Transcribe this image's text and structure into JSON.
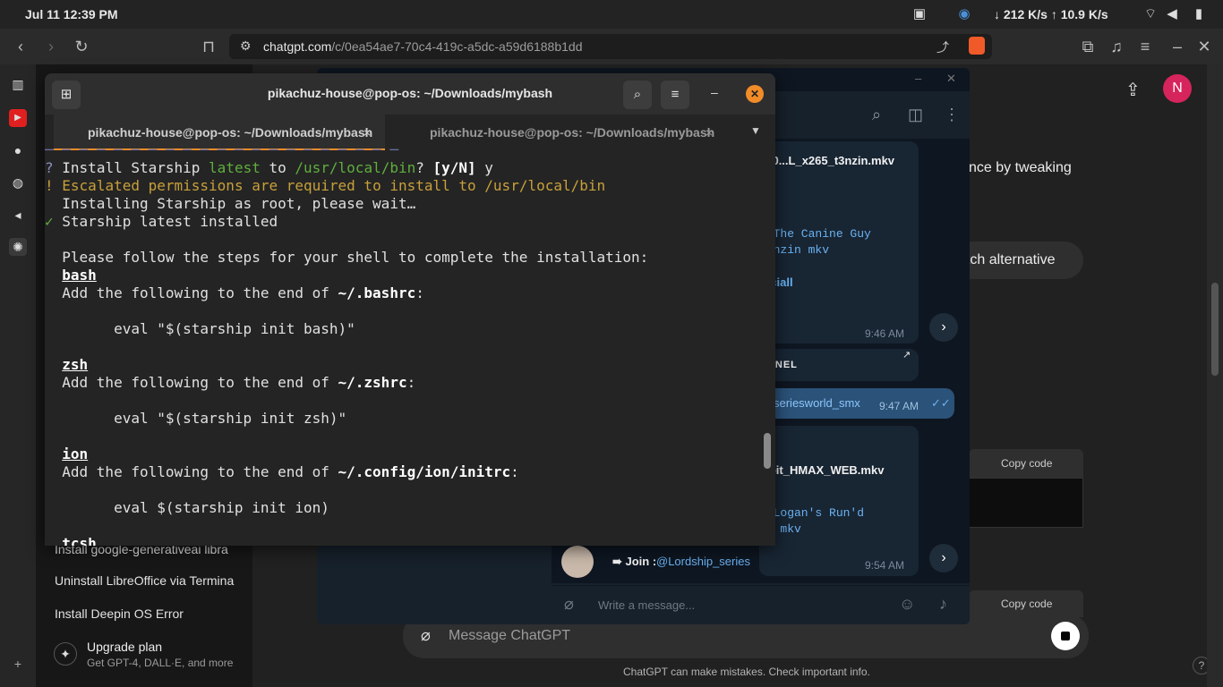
{
  "system": {
    "datetime": "Jul 11  12:39 PM",
    "network": "↓ 212 K/s ↑ 10.9 K/s"
  },
  "browser": {
    "url_host": "chatgpt.com",
    "url_path": "/c/0ea54ae7-70c4-419c-a5dc-a59d6188b1dd"
  },
  "chatgpt": {
    "history": [
      "Install google-generativeai libra",
      "Uninstall LibreOffice via Termina",
      "Install Deepin OS Error"
    ],
    "upgrade_title": "Upgrade plan",
    "upgrade_sub": "Get GPT-4, DALL·E, and more",
    "msg_fragment_1": "nce by tweaking",
    "msg_fragment_2": "etch alternative",
    "copy_code": "Copy code",
    "composer_placeholder": "Message ChatGPT",
    "disclaimer": "ChatGPT can make mistakes. Check important info.",
    "help": "?",
    "avatar_letter": "N"
  },
  "telegram": {
    "file1": "020...L_x265_t3nzin.mkv",
    "mono1a": "5 The Canine Guy",
    "mono1b": "t3nzin mkv",
    "link1a": "fficiall",
    "link1b": "al",
    "emoji1": "🎗",
    "time1": "9:46 AM",
    "channel": "ANNEL",
    "link2": "seriesworld_smx",
    "time2": "9:47 AM",
    "file2": ".0bit_HMAX_WEB.mkv",
    "mono2a": "3 Logan's Run'd",
    "mono2b": "EB mkv",
    "join_label": "➠ Join : ",
    "join_link": "@Lordship_series",
    "time3": "9:54 AM",
    "composer": "Write a message..."
  },
  "terminal": {
    "title": "pikachuz-house@pop-os: ~/Downloads/mybash",
    "tab1": "pikachuz-house@pop-os: ~/Downloads/mybash",
    "tab2": "pikachuz-house@pop-os: ~/Downloads/mybash",
    "prompt_q": "?",
    "l1a": "Install Starship ",
    "l1b": "latest",
    "l1c": " to ",
    "l1d": "/usr/local/bin",
    "l1e": "? ",
    "l1f": "[y/N]",
    "l1g": " y",
    "l2_mark": "!",
    "l2": "Escalated permissions are required to install to /usr/local/bin",
    "l3": "Installing Starship as root, please wait…",
    "l4_mark": "✓",
    "l4": "Starship latest installed",
    "l5": "Please follow the steps for your shell to complete the installation:",
    "bash": "bash",
    "add_prefix": "Add the following to the end of ",
    "bashrc": "~/.bashrc",
    "colon": ":",
    "eval_bash": "eval \"$(starship init bash)\"",
    "zsh": "zsh",
    "zshrc": "~/.zshrc",
    "eval_zsh": "eval \"$(starship init zsh)\"",
    "ion": "ion",
    "ionrc": "~/.config/ion/initrc",
    "eval_ion": "eval $(starship init ion)",
    "tcsh": "tcsh"
  }
}
